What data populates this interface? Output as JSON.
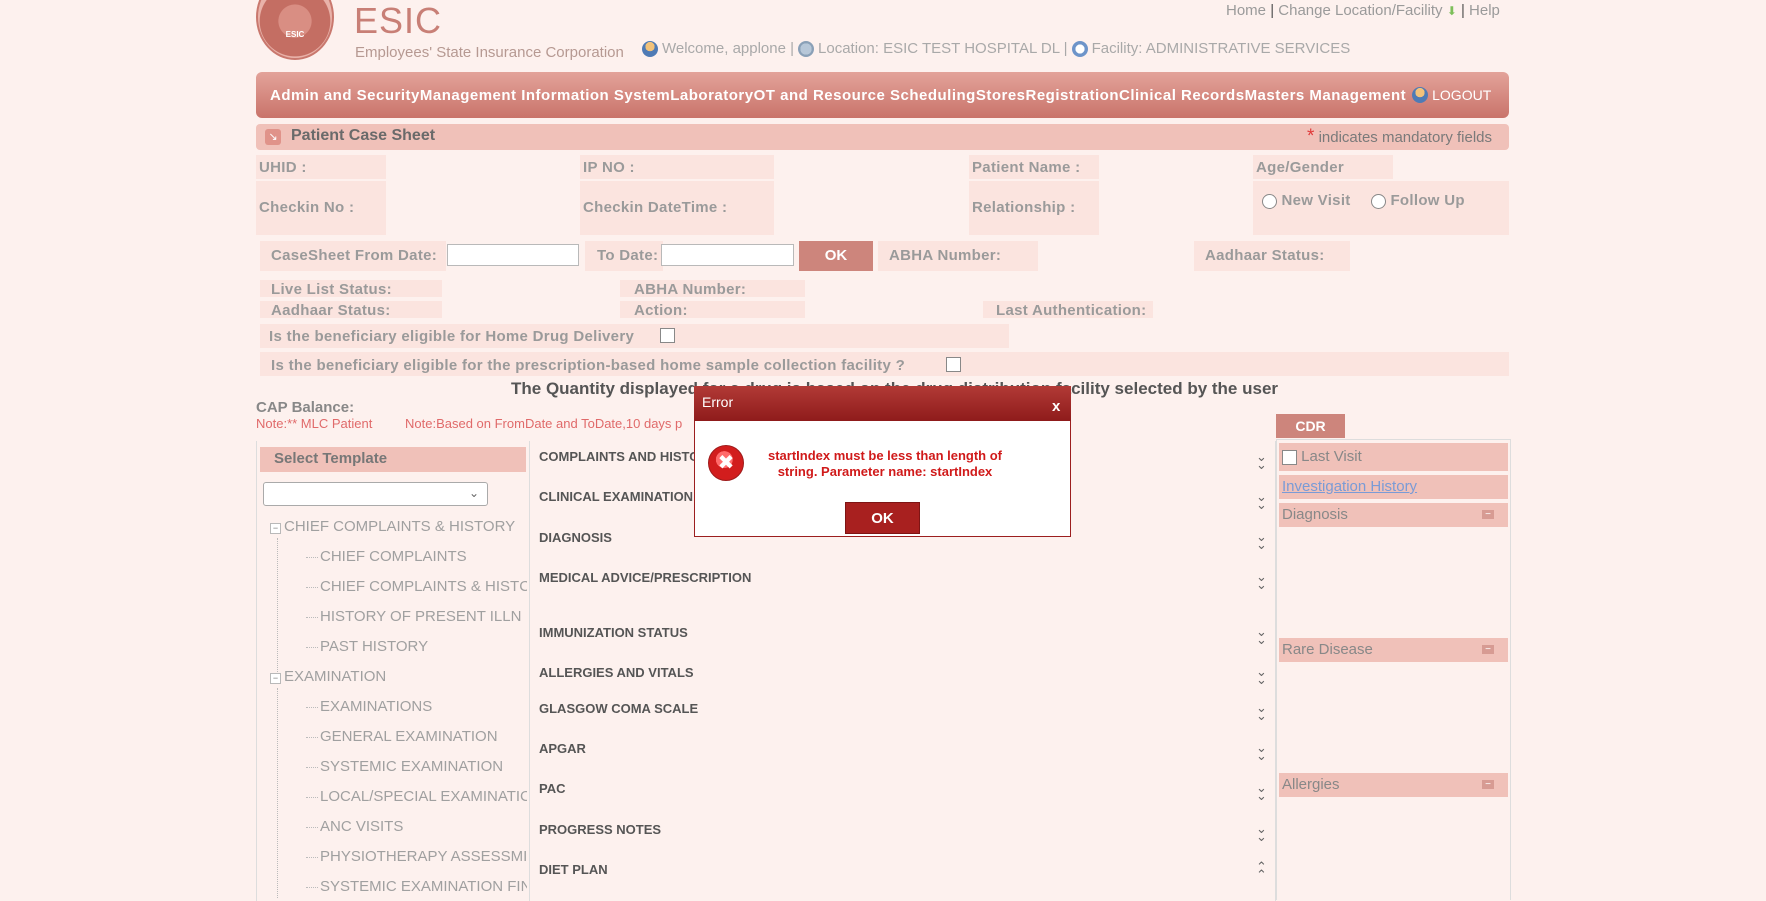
{
  "header": {
    "logo_text": "ESIC",
    "brand_title": "ESIC",
    "brand_subtitle": "Employees' State Insurance Corporation",
    "links": {
      "home": "Home",
      "change_location": "Change Location/Facility",
      "help": "Help"
    },
    "welcome": "Welcome, applone |",
    "location": "Location: ESIC TEST HOSPITAL DL |",
    "facility": "Facility: ADMINISTRATIVE SERVICES"
  },
  "menu": {
    "items": [
      "Admin and Security",
      "Management Information System",
      "Laboratory",
      "OT and Resource Scheduling",
      "Stores",
      "Registration",
      "Clinical Records",
      "Masters Management"
    ],
    "logout": "LOGOUT"
  },
  "section": {
    "title": "Patient Case Sheet",
    "mandatory_star": "*",
    "mandatory_note": "indicates mandatory fields"
  },
  "patient": {
    "uhid": "UHID :",
    "ip_no": "IP NO :",
    "patient_name": "Patient Name :",
    "age_gender": "Age/Gender",
    "checkin_no": "Checkin No :",
    "checkin_datetime": "Checkin DateTime :",
    "relationship": "Relationship :",
    "visit_new": "New Visit",
    "visit_follow": "Follow Up"
  },
  "filter": {
    "from_date": "CaseSheet From Date:",
    "to_date": "To Date:",
    "ok": "OK",
    "abha_number": "ABHA Number:",
    "aadhaar_status": "Aadhaar Status:"
  },
  "status": {
    "live_list": "Live List Status:",
    "abha_number": "ABHA Number:",
    "aadhaar_status": "Aadhaar Status:",
    "action": "Action:",
    "last_auth": "Last Authentication:"
  },
  "eligibility": {
    "home_drug": "Is the beneficiary eligible for Home Drug Delivery",
    "home_sample": "Is the beneficiary eligible for the prescription-based home sample collection facility ?"
  },
  "notes": {
    "quantity": "The Quantity displayed for a drug is based on the drug distribution facility selected by the user",
    "cap_balance": "CAP Balance:",
    "mlc": "Note:** MLC Patient",
    "date_range": "Note:Based on FromDate and ToDate,10 days p"
  },
  "template": {
    "header": "Select Template",
    "tree": [
      "CHIEF COMPLAINTS & HISTORY",
      "CHIEF COMPLAINTS",
      "CHIEF COMPLAINTS & HISTC",
      "HISTORY OF PRESENT ILLN",
      "PAST HISTORY",
      "EXAMINATION",
      "EXAMINATIONS",
      "GENERAL EXAMINATION",
      "SYSTEMIC EXAMINATION",
      "LOCAL/SPECIAL EXAMINATIC",
      "ANC VISITS",
      "PHYSIOTHERAPY ASSESSMI",
      "SYSTEMIC EXAMINATION FIN"
    ]
  },
  "sections": [
    "COMPLAINTS AND HISTO",
    "CLINICAL EXAMINATION",
    "DIAGNOSIS",
    "MEDICAL ADVICE/PRESCRIPTION",
    "IMMUNIZATION STATUS",
    "ALLERGIES AND VITALS",
    "GLASGOW COMA SCALE",
    "APGAR",
    "PAC",
    "PROGRESS NOTES",
    "DIET PLAN"
  ],
  "cdr": {
    "tab": "CDR",
    "last_visit": "Last Visit",
    "investigation_history": "Investigation History",
    "diagnosis": "Diagnosis",
    "rare_disease": "Rare Disease",
    "allergies": "Allergies"
  },
  "dialog": {
    "title": "Error",
    "close": "x",
    "message": "startIndex must be less than length of string. Parameter name: startIndex",
    "ok": "OK"
  }
}
